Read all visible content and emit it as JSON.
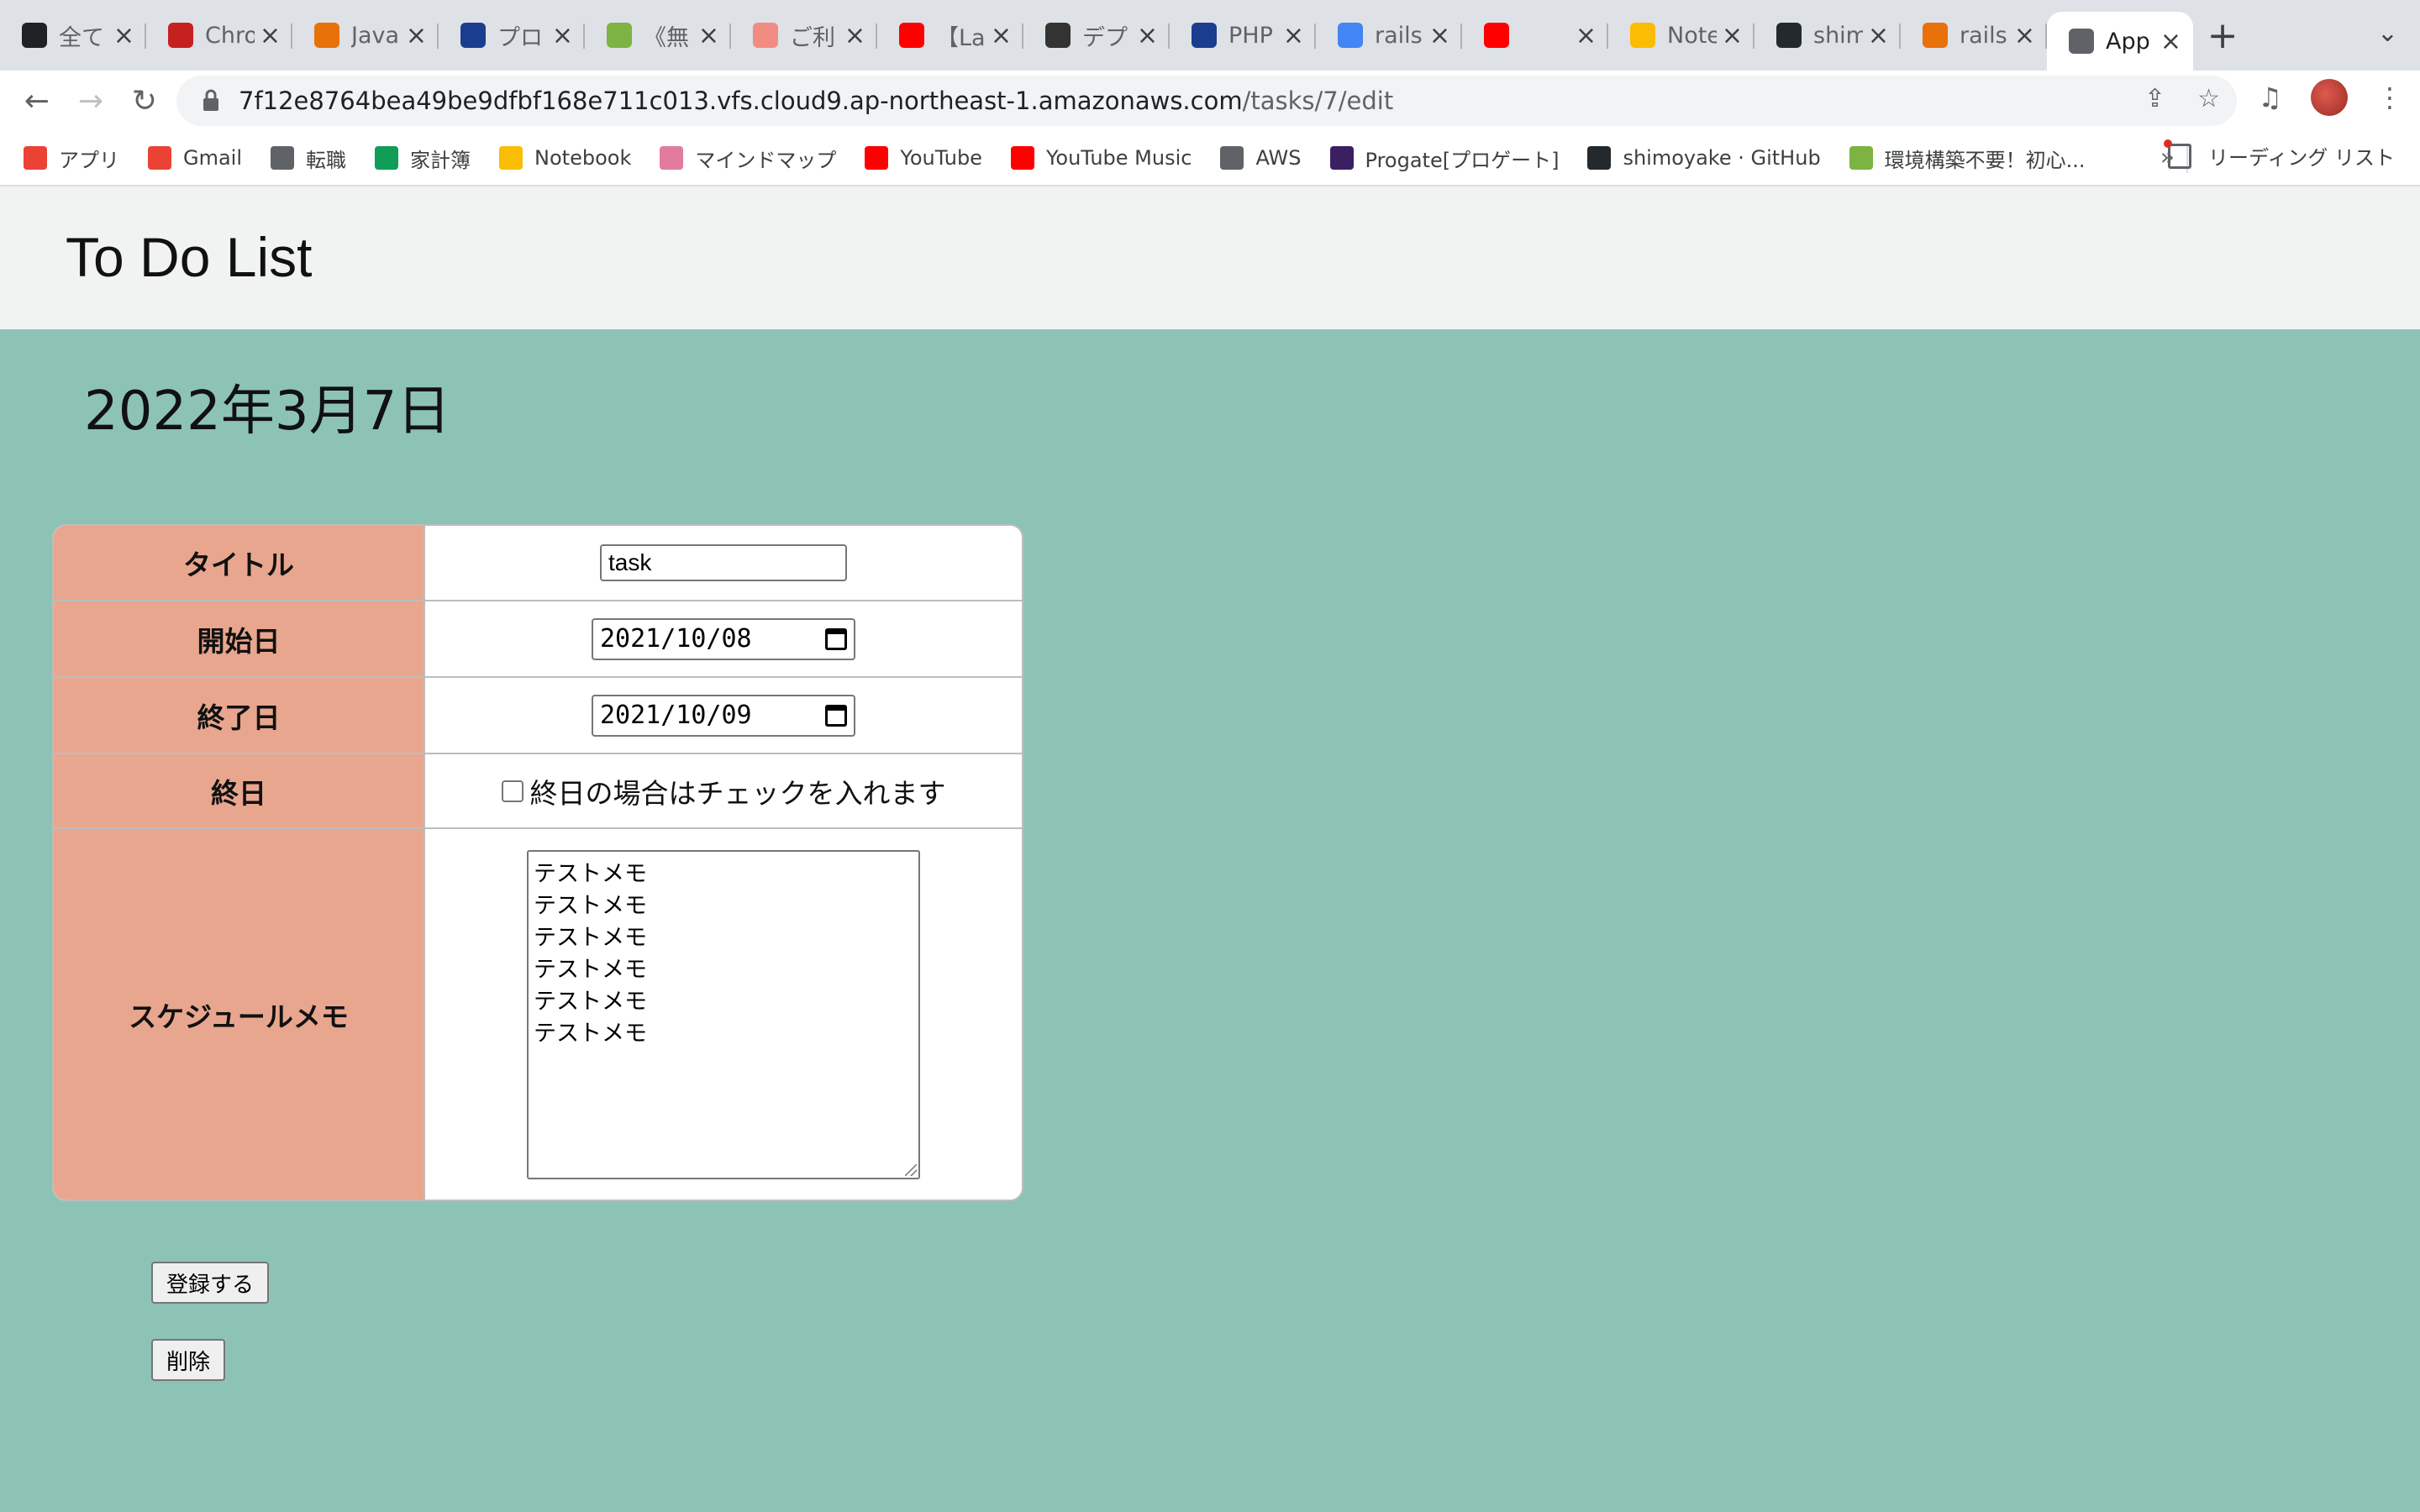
{
  "browser": {
    "tabs": [
      {
        "title": "全て",
        "icon": "hatena-icon",
        "color": "#202124"
      },
      {
        "title": "Chrome",
        "icon": "chrome-red-icon",
        "color": "#c5221f"
      },
      {
        "title": "Java",
        "icon": "re-icon",
        "color": "#e8710a"
      },
      {
        "title": "プロ",
        "icon": "play-icon",
        "color": "#1a3d8f"
      },
      {
        "title": "《無",
        "icon": "monitor-icon",
        "color": "#7cb342"
      },
      {
        "title": "ご利",
        "icon": "circle-icon",
        "color": "#f28b82"
      },
      {
        "title": "【La",
        "icon": "youtube-icon",
        "color": "#ff0000"
      },
      {
        "title": "デプ",
        "icon": "dark-square-icon",
        "color": "#333333"
      },
      {
        "title": "PHP",
        "icon": "bird-icon",
        "color": "#1a3d8f"
      },
      {
        "title": "rails",
        "icon": "google-icon",
        "color": "#4285f4"
      },
      {
        "title": "",
        "icon": "youtube-audio-icon",
        "color": "#ff0000"
      },
      {
        "title": "Note",
        "icon": "notebook-icon",
        "color": "#fbbc04"
      },
      {
        "title": "shim",
        "icon": "github-icon",
        "color": "#24292e"
      },
      {
        "title": "rails",
        "icon": "aws-cube-icon",
        "color": "#e8710a"
      },
      {
        "title": "App",
        "icon": "globe-icon",
        "color": "#5f6368",
        "active": true
      }
    ],
    "url_host": "7f12e8764bea49be9dfbf168e711c013.vfs.cloud9.ap-northeast-1.amazonaws.com",
    "url_path": "/tasks/7/edit",
    "bookmarks": [
      {
        "label": "アプリ",
        "icon": "apps-grid-icon"
      },
      {
        "label": "Gmail",
        "icon": "gmail-icon"
      },
      {
        "label": "転職",
        "icon": "folder-icon"
      },
      {
        "label": "家計簿",
        "icon": "sheets-icon"
      },
      {
        "label": "Notebook",
        "icon": "notebook-icon"
      },
      {
        "label": "マインドマップ",
        "icon": "mindmap-icon"
      },
      {
        "label": "YouTube",
        "icon": "youtube-icon"
      },
      {
        "label": "YouTube Music",
        "icon": "youtube-music-icon"
      },
      {
        "label": "AWS",
        "icon": "folder-icon"
      },
      {
        "label": "Progate[プロゲート]",
        "icon": "progate-icon"
      },
      {
        "label": "shimoyake · GitHub",
        "icon": "github-icon"
      },
      {
        "label": "環境構築不要！初心...",
        "icon": "paiza-icon"
      }
    ],
    "bookmarks_more": "»",
    "reading_list": "リーディング リスト"
  },
  "app": {
    "title": "To Do List",
    "date": "2022年3月7日"
  },
  "form": {
    "title_label": "タイトル",
    "title_value": "task",
    "start_label": "開始日",
    "start_value": "2021/10/08",
    "end_label": "終了日",
    "end_value": "2021/10/09",
    "allday_label": "終日",
    "allday_text": "終日の場合はチェックを入れます",
    "allday_checked": false,
    "memo_label": "スケジュールメモ",
    "memo_lines": [
      "テストメモ",
      "テストメモ",
      "テストメモ",
      "テストメモ",
      "テストメモ",
      "テストメモ"
    ],
    "submit_label": "登録する",
    "delete_label": "削除"
  }
}
